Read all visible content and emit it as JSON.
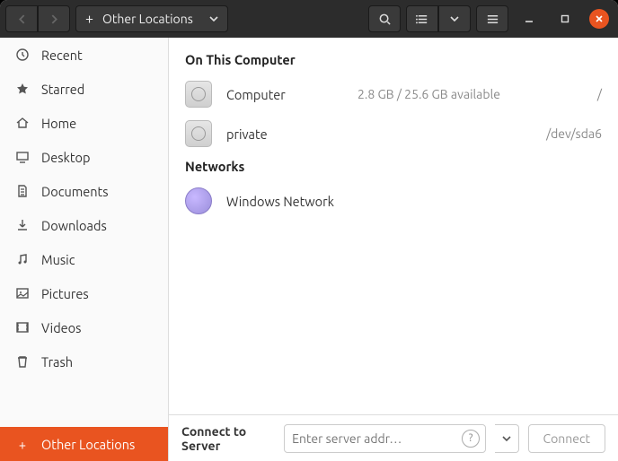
{
  "titlebar": {
    "location_label": "Other Locations"
  },
  "sidebar": {
    "items": [
      {
        "label": "Recent"
      },
      {
        "label": "Starred"
      },
      {
        "label": "Home"
      },
      {
        "label": "Desktop"
      },
      {
        "label": "Documents"
      },
      {
        "label": "Downloads"
      },
      {
        "label": "Music"
      },
      {
        "label": "Pictures"
      },
      {
        "label": "Videos"
      },
      {
        "label": "Trash"
      }
    ],
    "other_locations_label": "Other Locations"
  },
  "content": {
    "on_this_computer_header": "On This Computer",
    "networks_header": "Networks",
    "volumes": [
      {
        "name": "Computer",
        "meta": "2.8 GB / 25.6 GB available",
        "mount": "/"
      },
      {
        "name": "private",
        "meta": "",
        "mount": "/dev/sda6"
      }
    ],
    "networks": [
      {
        "name": "Windows Network"
      }
    ]
  },
  "footer": {
    "label": "Connect to Server",
    "placeholder": "Enter server addr…",
    "help": "?",
    "connect": "Connect"
  }
}
